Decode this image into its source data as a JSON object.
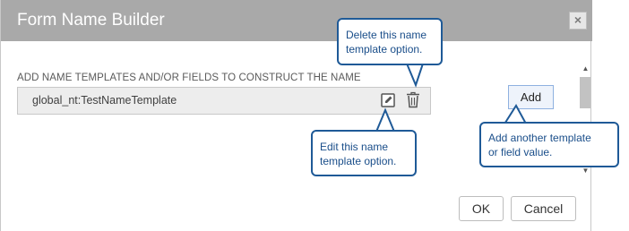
{
  "dialog": {
    "title": "Form Name Builder",
    "close_label": "×",
    "section_label": "ADD NAME TEMPLATES AND/OR FIELDS TO CONSTRUCT THE NAME",
    "template_value": "global_nt:TestNameTemplate",
    "add_label": "Add",
    "ok_label": "OK",
    "cancel_label": "Cancel"
  },
  "callouts": {
    "delete_line1": "Delete this name",
    "delete_line2": "template option.",
    "edit_line1": "Edit this name",
    "edit_line2": "template option.",
    "add_line1": "Add another template",
    "add_line2": "or field value."
  },
  "scrollbar": {
    "up_arrow": "▲",
    "down_arrow": "▼"
  },
  "icons": {
    "close": "close-icon",
    "edit": "edit-icon",
    "delete": "trash-icon"
  },
  "colors": {
    "titlebar": "#a9a9a9",
    "callout_border": "#1f5a97",
    "callout_text": "#1a4e8a",
    "add_button_border": "#8fb1e0"
  }
}
